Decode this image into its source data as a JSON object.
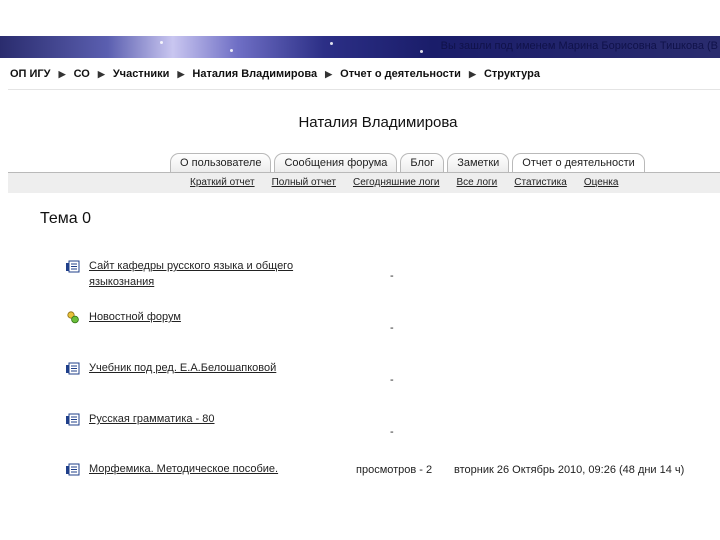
{
  "header": {
    "login_text": "Вы зашли под именем Марина Борисовна Тишкова (В"
  },
  "breadcrumb": [
    "ОП ИГУ",
    "СО",
    "Участники",
    "Наталия Владимирова",
    "Отчет о деятельности",
    "Структура"
  ],
  "user_name": "Наталия Владимирова",
  "tabs": [
    "О пользователе",
    "Сообщения форума",
    "Блог",
    "Заметки",
    "Отчет о деятельности"
  ],
  "subtabs": [
    "Краткий отчет",
    "Полный отчет",
    "Сегодняшние логи",
    "Все логи",
    "Статистика",
    "Оценка"
  ],
  "section_title": "Тема 0",
  "activities": [
    {
      "icon": "page-icon",
      "name": "Сайт кафедры русского языка и общего языкознания",
      "views": "-",
      "last_access": ""
    },
    {
      "icon": "forum-icon",
      "name": "Новостной форум",
      "views": "-",
      "last_access": ""
    },
    {
      "icon": "page-icon",
      "name": "Учебник под ред. Е.А.Белошапковой",
      "views": "-",
      "last_access": ""
    },
    {
      "icon": "page-icon",
      "name": "Русская грамматика - 80",
      "views": "-",
      "last_access": ""
    },
    {
      "icon": "page-icon",
      "name": "Морфемика. Методическое пособие.",
      "views": "просмотров - 2",
      "last_access": "вторник 26 Октябрь 2010, 09:26 (48 дни 14 ч)"
    }
  ]
}
